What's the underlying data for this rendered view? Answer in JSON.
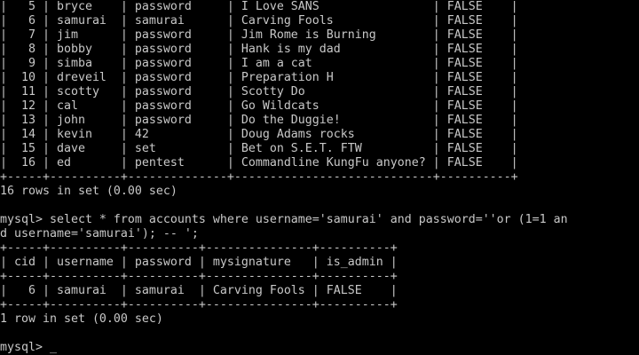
{
  "terminal": {
    "background": "#000000",
    "foreground": "#c8c8c8",
    "lines": [
      "|   5 | bryce    | password     | I Love SANS                | FALSE    |",
      "|   6 | samurai  | samurai      | Carving Fools              | FALSE    |",
      "|   7 | jim      | password     | Jim Rome is Burning        | FALSE    |",
      "|   8 | bobby    | password     | Hank is my dad             | FALSE    |",
      "|   9 | simba    | password     | I am a cat                 | FALSE    |",
      "|  10 | dreveil  | password     | Preparation H              | FALSE    |",
      "|  11 | scotty   | password     | Scotty Do                  | FALSE    |",
      "|  12 | cal      | password     | Go Wildcats                | FALSE    |",
      "|  13 | john     | password     | Do the Duggie!             | FALSE    |",
      "|  14 | kevin    | 42           | Doug Adams rocks           | FALSE    |",
      "|  15 | dave     | set          | Bet on S.E.T. FTW          | FALSE    |",
      "|  16 | ed       | pentest      | Commandline KungFu anyone? | FALSE    |",
      "+-----+----------+--------------+----------------------------+----------+",
      "16 rows in set (0.00 sec)",
      "",
      "mysql> select * from accounts where username='samurai' and password=''or (1=1 an",
      "d username='samurai'); -- ';",
      "+-----+----------+----------+---------------+----------+",
      "| cid | username | password | mysignature   | is_admin |",
      "+-----+----------+----------+---------------+----------+",
      "|   6 | samurai  | samurai  | Carving Fools | FALSE    |",
      "+-----+----------+----------+---------------+----------+",
      "1 row in set (0.00 sec)",
      "",
      "mysql> "
    ],
    "cursor": "_"
  }
}
